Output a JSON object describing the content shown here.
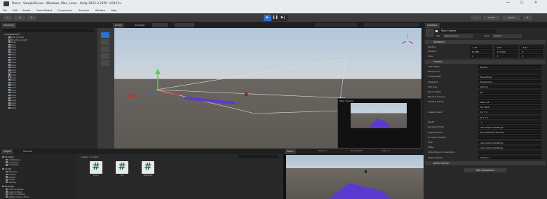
{
  "window": {
    "title": "Pierre - SampleScene - Windows, Mac, Linux - Unity 2022.3.23f1* <DX11>",
    "controls": [
      "—",
      "☐",
      "✕"
    ]
  },
  "menu": [
    "File",
    "Edit",
    "Assets",
    "GameObject",
    "Component",
    "Services",
    "Window",
    "Help"
  ],
  "toolbar": {
    "account": "P",
    "layers_label": "Layers",
    "layout_label": "Layout"
  },
  "hierarchy": {
    "tab": "Hierarchy",
    "scene": "SampleScene*",
    "items": [
      "Main Camera",
      "Directional Light",
      "Cube",
      "Floor",
      "Cube",
      "Cube",
      "Cube",
      "Cube",
      "Cube",
      "Cube",
      "Cube",
      "Cube",
      "Cube",
      "Cube",
      "Cube",
      "Cube",
      "Cube",
      "Cube",
      "Cube",
      "Cube",
      "Cube",
      "Cube",
      "Cube",
      "Cube",
      "Cube",
      "Cube",
      "Cube",
      "Cube",
      "Cube"
    ]
  },
  "scene": {
    "tabs": [
      "Scene",
      "Animator"
    ],
    "gizmo_label": "Persp"
  },
  "camera_preview_label": "Main Camera",
  "inspector": {
    "tab": "Inspector",
    "object_name": "Main Camera",
    "tag_label": "Tag",
    "tag_value": "MainCamera",
    "layer_label": "Layer",
    "layer_value": "Default",
    "transform": {
      "header": "Transform",
      "rows": [
        {
          "label": "Position",
          "x": "-1.43",
          "y": "0.45",
          "z": "-6.13"
        },
        {
          "label": "Rotation",
          "x": "10.685",
          "y": "171.669",
          "z": "0"
        },
        {
          "label": "Scale",
          "x": "1",
          "y": "1",
          "z": "1"
        }
      ]
    },
    "camera": {
      "header": "Camera",
      "rows": [
        {
          "label": "Clear Flags",
          "value": "Skybox"
        },
        {
          "label": "Background",
          "value": ""
        },
        {
          "label": "Culling Mask",
          "value": "Everything"
        },
        {
          "label": "Projection",
          "value": "Perspective"
        },
        {
          "label": "FOV Axis",
          "value": "Vertical"
        },
        {
          "label": "Field of View",
          "value": "60"
        },
        {
          "label": "Physical Camera",
          "value": ""
        },
        {
          "label": "Clipping Planes",
          "value": "Near 0.3"
        },
        {
          "label": "",
          "value": "Far 1000"
        },
        {
          "label": "Viewport Rect",
          "value": "X 0   Y 0"
        },
        {
          "label": "",
          "value": "W 1   H 1"
        },
        {
          "label": "Depth",
          "value": "-1"
        },
        {
          "label": "Rendering Path",
          "value": "Use Graphics Settings"
        },
        {
          "label": "Target Texture",
          "value": "None (Render Texture)"
        },
        {
          "label": "Occlusion Culling",
          "value": ""
        },
        {
          "label": "HDR",
          "value": "Use Graphics Settings"
        },
        {
          "label": "MSAA",
          "value": "Use Graphics Settings"
        },
        {
          "label": "Allow Dynamic Resolution",
          "value": ""
        },
        {
          "label": "Target Display",
          "value": "Display 1"
        }
      ]
    },
    "audio_listener_header": "Audio Listener",
    "add_component": "Add Component"
  },
  "project": {
    "tabs": [
      "Project",
      "Console"
    ],
    "tree": {
      "favorites": "Favorites",
      "favorites_items": [
        "All Materials",
        "All Models",
        "All Prefabs"
      ],
      "assets": "Assets",
      "assets_items": [
        "Materials",
        "Prefabs",
        "Scenes",
        "Scripts",
        "Settings"
      ],
      "packages": "Packages",
      "packages_items": [
        "Code Coverage",
        "Custom NUnit",
        "Editor Coroutines",
        "JetBrains Rider Editor"
      ]
    },
    "breadcrumb": "Assets > Scripts",
    "assets": [
      {
        "name": "Player"
      },
      {
        "name": "Obj"
      },
      {
        "name": "Obstacles"
      }
    ]
  },
  "game": {
    "tab": "Game",
    "display": "Display 1",
    "aspect": "Free Aspect",
    "scale": "Scale 1x"
  },
  "colors": {
    "gizmo_y": "#5fcf3a",
    "gizmo_x": "#cf3a3a",
    "gizmo_z": "#3a6acf",
    "bar_purple": "#5a3ad0",
    "accent_blue": "#2b6fd1"
  }
}
